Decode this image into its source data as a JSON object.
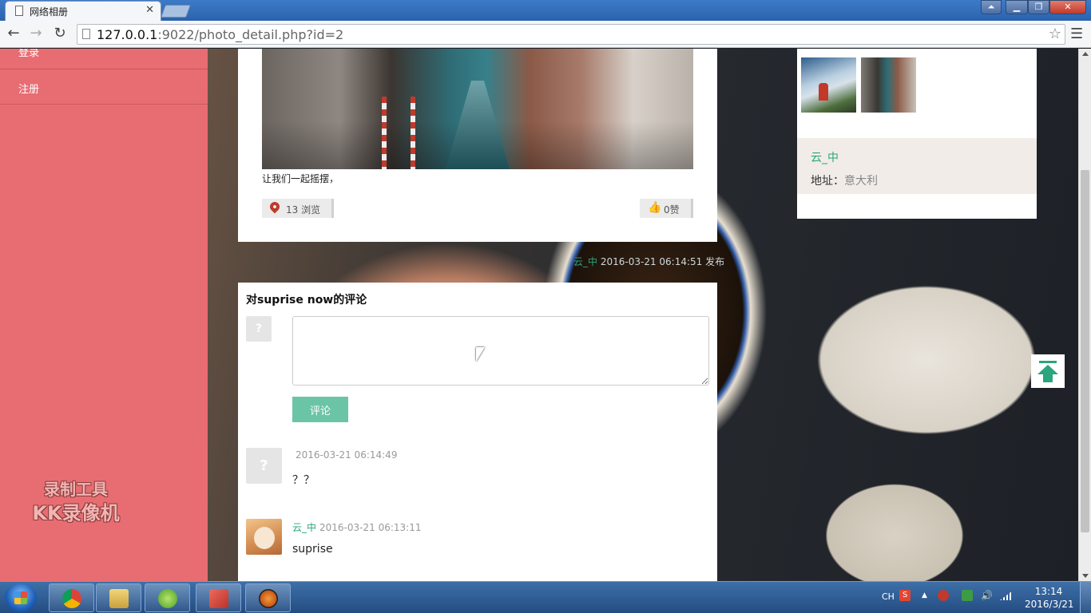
{
  "browser": {
    "tab_title": "网络相册",
    "url_host": "127.0.0.1",
    "url_rest": ":9022/photo_detail.php?id=2"
  },
  "sidebar": {
    "items": [
      {
        "label": "登录"
      },
      {
        "label": "注册"
      }
    ],
    "watermark_line1": "录制工具",
    "watermark_line2": "KK录像机"
  },
  "post": {
    "caption": "让我们一起摇摆，",
    "views": "13 浏览",
    "likes": "0赞",
    "meta_user": "云_中",
    "meta_date": "2016-03-21 06:14:51",
    "meta_suffix": "发布"
  },
  "profile": {
    "name": "云_中",
    "address_label": "地址：",
    "address_value": "意大利"
  },
  "comments_section": {
    "title": "对suprise now的评论",
    "input_value": "",
    "submit_label": "评论",
    "items": [
      {
        "user": "",
        "date": "2016-03-21 06:14:49",
        "text": "？？"
      },
      {
        "user": "云_中",
        "date": "2016-03-21 06:13:11",
        "text": "suprise"
      }
    ]
  },
  "taskbar": {
    "tray_lang": "CH",
    "clock_time": "13:14",
    "clock_date": "2016/3/21"
  },
  "colors": {
    "sidebar": "#e86d72",
    "accent": "#2aa57e",
    "submit_button": "#6bc4a6",
    "like_icon": "#d0302f"
  }
}
